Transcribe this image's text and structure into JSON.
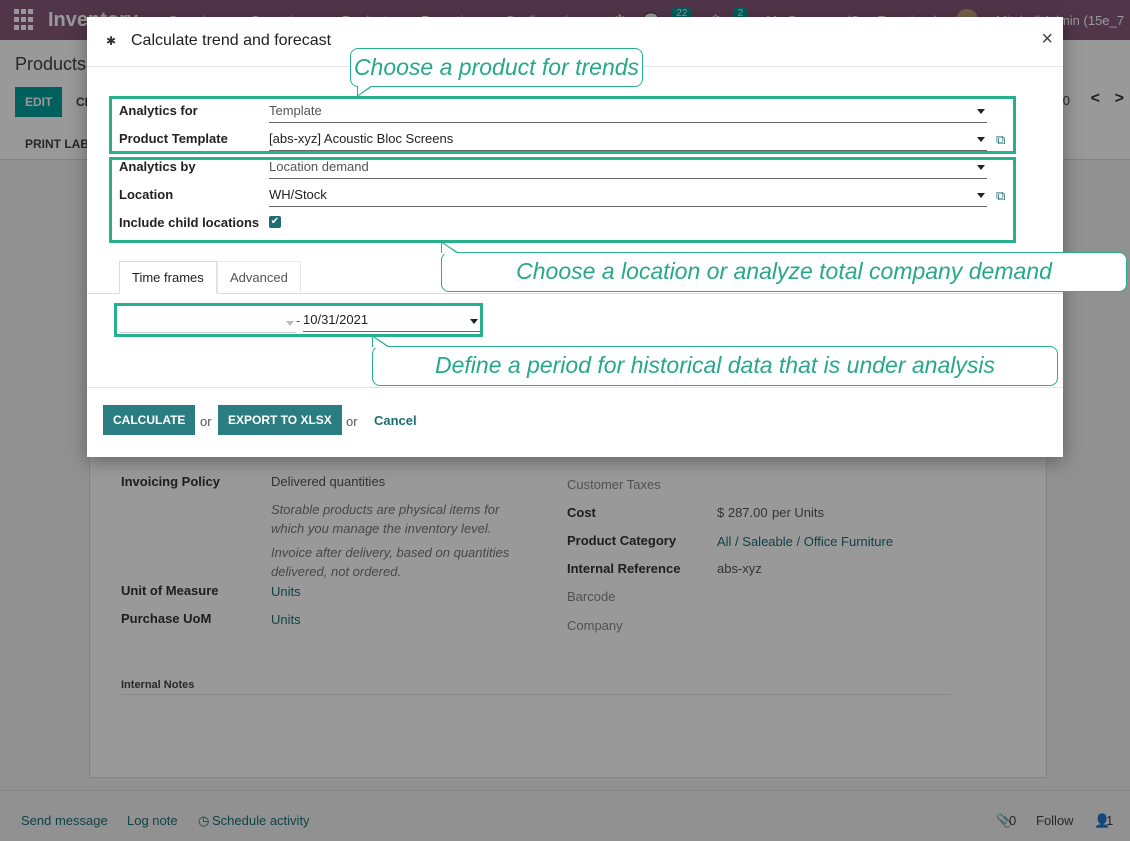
{
  "navbar": {
    "app_name": "Inventory",
    "menu": [
      "Overview",
      "Operations",
      "Products",
      "Reporting",
      "Configuration"
    ],
    "messages_count": "22",
    "activities_count": "2",
    "company": "My Company (San Francisco)",
    "user": "Mitchell Admin (15e_7"
  },
  "control_panel": {
    "breadcrumb": "Products",
    "edit_label": "EDIT",
    "create_label": "CI",
    "print_label": "PRINT LAB",
    "pager": "0"
  },
  "form": {
    "invoicing_policy_label": "Invoicing Policy",
    "invoicing_policy_value": "Delivered quantities",
    "help_1": "Storable products are physical items for which you manage the inventory level.",
    "help_2": "Invoice after delivery, based on quantities delivered, not ordered.",
    "uom_label": "Unit of Measure",
    "uom_value": "Units",
    "purchase_uom_label": "Purchase UoM",
    "purchase_uom_value": "Units",
    "customer_taxes_label": "Customer Taxes",
    "cost_label": "Cost",
    "cost_value": "$ 287.00",
    "cost_unit": "per Units",
    "category_label": "Product Category",
    "category_value": "All / Saleable / Office Furniture",
    "internal_ref_label": "Internal Reference",
    "internal_ref_value": "abs-xyz",
    "barcode_label": "Barcode",
    "company_label": "Company",
    "internal_notes_label": "Internal Notes"
  },
  "chatter": {
    "send_message": "Send message",
    "log_note": "Log note",
    "schedule_activity": "Schedule activity",
    "attachments": "0",
    "follow": "Follow",
    "followers": "1"
  },
  "modal": {
    "title": "Calculate trend and forecast",
    "close": "×",
    "analytics_for_label": "Analytics for",
    "analytics_for_value": "Template",
    "product_template_label": "Product Template",
    "product_template_value": "[abs-xyz] Acoustic Bloc Screens",
    "analytics_by_label": "Analytics by",
    "analytics_by_value": "Location demand",
    "location_label": "Location",
    "location_value": "WH/Stock",
    "include_child_label": "Include child locations",
    "tabs": [
      "Time frames",
      "Advanced"
    ],
    "date_separator": "-",
    "date_to": "10/31/2021",
    "calculate_label": "CALCULATE",
    "or": "or",
    "export_label": "EXPORT TO XLSX",
    "cancel_label": "Cancel"
  },
  "annotations": {
    "callout_product": "Choose a product for trends",
    "callout_location": "Choose a location or analyze total company demand",
    "callout_period": "Define a period for historical data that is under analysis"
  },
  "colors": {
    "navbar": "#875A7B",
    "primary_button": "#2a7d80",
    "highlight": "#26b08d",
    "link": "#1d6e74"
  }
}
